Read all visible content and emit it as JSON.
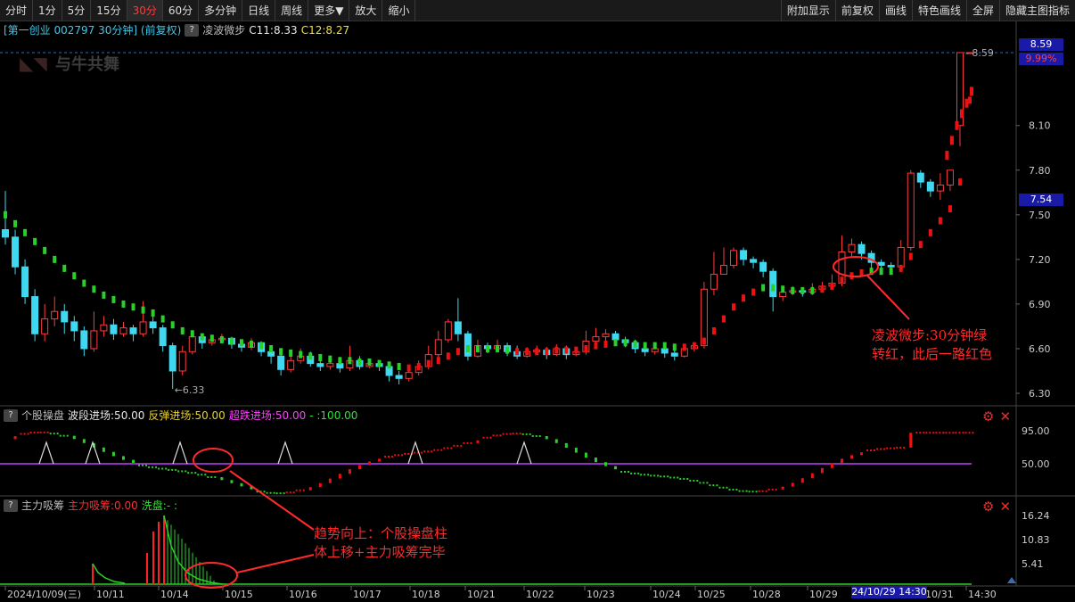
{
  "toolbar": {
    "left": [
      "分时",
      "1分",
      "5分",
      "15分",
      "30分",
      "60分",
      "多分钟",
      "日线",
      "周线",
      "更多▼",
      "放大",
      "缩小"
    ],
    "active": "30分",
    "right": [
      "附加显示",
      "前复权",
      "画线",
      "特色画线",
      "全屏",
      "隐藏主图指标"
    ]
  },
  "main": {
    "title": "[第一创业 002797 30分钟] (前复权)",
    "indicator_name": "凌波微步",
    "c11": "C11:8.33",
    "c12": "C12:8.27",
    "watermark": "与牛共舞",
    "price_ticks": [
      "8.10",
      "7.80",
      "7.50",
      "7.20",
      "6.90",
      "6.60",
      "6.30"
    ],
    "current_price": "8.59",
    "current_pct": "9.99%",
    "cursor_price": "7.54",
    "high_label": "8.59",
    "low_label": "6.33"
  },
  "pane2": {
    "name": "个股操盘",
    "labels": [
      {
        "text": "波段进场:50.00",
        "color": "#e8e8e8"
      },
      {
        "text": "反弹进场:50.00",
        "color": "#e8d030"
      },
      {
        "text": "超跌进场:50.00",
        "color": "#ff40ff"
      },
      {
        "text": "- :100.00",
        "color": "#35e035"
      }
    ],
    "ticks": [
      "95.00",
      "50.00"
    ]
  },
  "pane3": {
    "name": "主力吸筹",
    "labels": [
      {
        "text": "主力吸筹:0.00",
        "color": "#ff3030"
      },
      {
        "text": "洗盘:- :",
        "color": "#35e035"
      }
    ],
    "ticks": [
      "16.24",
      "10.83",
      "5.41"
    ]
  },
  "dates": [
    "2024/10/09(三)",
    "10/11",
    "10/14",
    "10/15",
    "10/16",
    "10/17",
    "10/18",
    "10/21",
    "10/22",
    "10/23",
    "10/24",
    "10/25",
    "10/28",
    "10/29",
    "10/31",
    "14:30"
  ],
  "cursor_date": "24/10/29 14:30",
  "annotations": {
    "right": [
      "凌波微步:30分钟绿",
      "转红，此后一路红色"
    ],
    "bottom": [
      "趋势向上：个股操盘柱",
      "体上移+主力吸筹完毕"
    ]
  },
  "colors": {
    "up": "#ff3b3b",
    "down": "#3fd8f0",
    "ma_green": "#2ad02a",
    "ma_red": "#ee1111",
    "midline": "#c040ff",
    "annotation": "#ff2a2a"
  },
  "chart_data": {
    "type": "candlestick",
    "interval": "30分钟",
    "candles": [
      [
        7.4,
        7.35,
        7.66,
        7.3
      ],
      [
        7.35,
        7.15,
        7.4,
        7.1
      ],
      [
        7.15,
        6.95,
        7.2,
        6.9
      ],
      [
        6.95,
        6.7,
        7.0,
        6.65
      ],
      [
        6.7,
        6.8,
        6.9,
        6.65
      ],
      [
        6.8,
        6.85,
        6.95,
        6.75
      ],
      [
        6.85,
        6.78,
        6.9,
        6.7
      ],
      [
        6.78,
        6.72,
        6.82,
        6.65
      ],
      [
        6.72,
        6.6,
        6.75,
        6.55
      ],
      [
        6.6,
        6.72,
        6.85,
        6.58
      ],
      [
        6.72,
        6.76,
        6.82,
        6.68
      ],
      [
        6.76,
        6.7,
        6.8,
        6.66
      ],
      [
        6.7,
        6.74,
        6.78,
        6.68
      ],
      [
        6.74,
        6.7,
        6.76,
        6.65
      ],
      [
        6.7,
        6.78,
        6.92,
        6.68
      ],
      [
        6.78,
        6.74,
        6.82,
        6.7
      ],
      [
        6.74,
        6.62,
        6.76,
        6.58
      ],
      [
        6.62,
        6.45,
        6.64,
        6.33
      ],
      [
        6.45,
        6.58,
        6.62,
        6.42
      ],
      [
        6.58,
        6.68,
        6.72,
        6.56
      ],
      [
        6.68,
        6.64,
        6.7,
        6.6
      ],
      [
        6.64,
        6.66,
        6.68,
        6.62
      ],
      [
        6.66,
        6.67,
        6.7,
        6.64
      ],
      [
        6.67,
        6.63,
        6.68,
        6.6
      ],
      [
        6.63,
        6.61,
        6.66,
        6.58
      ],
      [
        6.61,
        6.64,
        6.67,
        6.59
      ],
      [
        6.64,
        6.58,
        6.65,
        6.55
      ],
      [
        6.58,
        6.55,
        6.6,
        6.5
      ],
      [
        6.55,
        6.46,
        6.57,
        6.42
      ],
      [
        6.46,
        6.52,
        6.56,
        6.44
      ],
      [
        6.52,
        6.55,
        6.6,
        6.5
      ],
      [
        6.55,
        6.5,
        6.58,
        6.48
      ],
      [
        6.5,
        6.48,
        6.53,
        6.45
      ],
      [
        6.48,
        6.5,
        6.55,
        6.46
      ],
      [
        6.5,
        6.47,
        6.52,
        6.44
      ],
      [
        6.47,
        6.52,
        6.62,
        6.45
      ],
      [
        6.52,
        6.48,
        6.55,
        6.46
      ],
      [
        6.48,
        6.5,
        6.53,
        6.47
      ],
      [
        6.5,
        6.48,
        6.52,
        6.45
      ],
      [
        6.48,
        6.42,
        6.5,
        6.38
      ],
      [
        6.42,
        6.4,
        6.45,
        6.36
      ],
      [
        6.4,
        6.44,
        6.46,
        6.38
      ],
      [
        6.44,
        6.48,
        6.52,
        6.42
      ],
      [
        6.48,
        6.56,
        6.62,
        6.46
      ],
      [
        6.56,
        6.66,
        6.72,
        6.54
      ],
      [
        6.66,
        6.78,
        6.8,
        6.64
      ],
      [
        6.78,
        6.7,
        6.94,
        6.65
      ],
      [
        6.7,
        6.55,
        6.72,
        6.52
      ],
      [
        6.55,
        6.62,
        6.66,
        6.54
      ],
      [
        6.62,
        6.6,
        6.64,
        6.57
      ],
      [
        6.6,
        6.62,
        6.66,
        6.58
      ],
      [
        6.62,
        6.58,
        6.64,
        6.55
      ],
      [
        6.58,
        6.55,
        6.62,
        6.53
      ],
      [
        6.55,
        6.58,
        6.61,
        6.54
      ],
      [
        6.58,
        6.59,
        6.62,
        6.56
      ],
      [
        6.59,
        6.56,
        6.61,
        6.53
      ],
      [
        6.56,
        6.6,
        6.63,
        6.55
      ],
      [
        6.6,
        6.56,
        6.62,
        6.53
      ],
      [
        6.56,
        6.58,
        6.6,
        6.55
      ],
      [
        6.58,
        6.65,
        6.72,
        6.56
      ],
      [
        6.65,
        6.68,
        6.74,
        6.62
      ],
      [
        6.68,
        6.7,
        6.73,
        6.64
      ],
      [
        6.7,
        6.66,
        6.72,
        6.62
      ],
      [
        6.66,
        6.64,
        6.68,
        6.61
      ],
      [
        6.64,
        6.6,
        6.66,
        6.57
      ],
      [
        6.6,
        6.58,
        6.62,
        6.55
      ],
      [
        6.58,
        6.6,
        6.62,
        6.56
      ],
      [
        6.6,
        6.57,
        6.62,
        6.54
      ],
      [
        6.57,
        6.55,
        6.59,
        6.52
      ],
      [
        6.55,
        6.6,
        6.63,
        6.54
      ],
      [
        6.6,
        6.62,
        6.64,
        6.58
      ],
      [
        6.62,
        7.0,
        7.05,
        6.6
      ],
      [
        7.0,
        7.1,
        7.25,
        6.96
      ],
      [
        7.1,
        7.16,
        7.28,
        7.1
      ],
      [
        7.16,
        7.26,
        7.28,
        7.14
      ],
      [
        7.26,
        7.2,
        7.28,
        7.16
      ],
      [
        7.2,
        7.18,
        7.22,
        7.14
      ],
      [
        7.18,
        7.12,
        7.2,
        7.08
      ],
      [
        7.12,
        6.95,
        7.14,
        6.85
      ],
      [
        6.95,
        6.98,
        7.02,
        6.92
      ],
      [
        6.98,
        6.99,
        7.02,
        6.96
      ],
      [
        6.99,
        6.98,
        7.01,
        6.95
      ],
      [
        6.98,
        7.0,
        7.04,
        6.96
      ],
      [
        7.0,
        7.02,
        7.05,
        6.98
      ],
      [
        7.02,
        7.04,
        7.1,
        7.0
      ],
      [
        7.04,
        7.25,
        7.36,
        7.02
      ],
      [
        7.25,
        7.3,
        7.34,
        7.22
      ],
      [
        7.3,
        7.24,
        7.32,
        7.2
      ],
      [
        7.24,
        7.18,
        7.26,
        7.14
      ],
      [
        7.18,
        7.16,
        7.2,
        7.12
      ],
      [
        7.16,
        7.15,
        7.18,
        7.13
      ],
      [
        7.15,
        7.28,
        7.33,
        7.12
      ],
      [
        7.28,
        7.78,
        7.8,
        7.26
      ],
      [
        7.78,
        7.72,
        7.8,
        7.68
      ],
      [
        7.72,
        7.66,
        7.74,
        7.62
      ],
      [
        7.66,
        7.7,
        7.78,
        7.6
      ],
      [
        7.7,
        7.8,
        7.8,
        7.66
      ],
      [
        8.1,
        8.59,
        8.59,
        7.96
      ],
      [
        8.59,
        8.59,
        8.59,
        8.59
      ]
    ],
    "lingbo_weibu": [
      [
        7.5,
        "g"
      ],
      [
        7.44,
        "g"
      ],
      [
        7.38,
        "g"
      ],
      [
        7.32,
        "g"
      ],
      [
        7.26,
        "g"
      ],
      [
        7.2,
        "g"
      ],
      [
        7.14,
        "g"
      ],
      [
        7.09,
        "g"
      ],
      [
        7.04,
        "g"
      ],
      [
        7.0,
        "g"
      ],
      [
        6.96,
        "g"
      ],
      [
        6.93,
        "g"
      ],
      [
        6.9,
        "g"
      ],
      [
        6.88,
        "g"
      ],
      [
        6.86,
        "g"
      ],
      [
        6.84,
        "g"
      ],
      [
        6.8,
        "g"
      ],
      [
        6.76,
        "g"
      ],
      [
        6.72,
        "g"
      ],
      [
        6.7,
        "g"
      ],
      [
        6.68,
        "g"
      ],
      [
        6.67,
        "g"
      ],
      [
        6.66,
        "g"
      ],
      [
        6.65,
        "g"
      ],
      [
        6.64,
        "g"
      ],
      [
        6.63,
        "g"
      ],
      [
        6.62,
        "g"
      ],
      [
        6.6,
        "g"
      ],
      [
        6.58,
        "g"
      ],
      [
        6.57,
        "g"
      ],
      [
        6.56,
        "g"
      ],
      [
        6.55,
        "g"
      ],
      [
        6.54,
        "g"
      ],
      [
        6.53,
        "g"
      ],
      [
        6.52,
        "g"
      ],
      [
        6.52,
        "g"
      ],
      [
        6.51,
        "g"
      ],
      [
        6.51,
        "g"
      ],
      [
        6.5,
        "g"
      ],
      [
        6.49,
        "g"
      ],
      [
        6.48,
        "g"
      ],
      [
        6.47,
        "r"
      ],
      [
        6.48,
        "r"
      ],
      [
        6.5,
        "r"
      ],
      [
        6.52,
        "r"
      ],
      [
        6.55,
        "r"
      ],
      [
        6.58,
        "r"
      ],
      [
        6.6,
        "g"
      ],
      [
        6.6,
        "g"
      ],
      [
        6.6,
        "g"
      ],
      [
        6.6,
        "g"
      ],
      [
        6.59,
        "g"
      ],
      [
        6.58,
        "r"
      ],
      [
        6.58,
        "r"
      ],
      [
        6.58,
        "r"
      ],
      [
        6.58,
        "r"
      ],
      [
        6.59,
        "r"
      ],
      [
        6.59,
        "r"
      ],
      [
        6.59,
        "r"
      ],
      [
        6.6,
        "r"
      ],
      [
        6.62,
        "r"
      ],
      [
        6.63,
        "r"
      ],
      [
        6.64,
        "g"
      ],
      [
        6.64,
        "g"
      ],
      [
        6.63,
        "g"
      ],
      [
        6.62,
        "g"
      ],
      [
        6.62,
        "g"
      ],
      [
        6.62,
        "g"
      ],
      [
        6.61,
        "g"
      ],
      [
        6.61,
        "r"
      ],
      [
        6.62,
        "r"
      ],
      [
        6.65,
        "r"
      ],
      [
        6.72,
        "r"
      ],
      [
        6.8,
        "r"
      ],
      [
        6.88,
        "r"
      ],
      [
        6.94,
        "r"
      ],
      [
        6.98,
        "r"
      ],
      [
        7.01,
        "g"
      ],
      [
        7.01,
        "g"
      ],
      [
        7.0,
        "g"
      ],
      [
        6.99,
        "g"
      ],
      [
        6.99,
        "g"
      ],
      [
        6.99,
        "g"
      ],
      [
        7.0,
        "r"
      ],
      [
        7.02,
        "r"
      ],
      [
        7.06,
        "r"
      ],
      [
        7.09,
        "r"
      ],
      [
        7.11,
        "r"
      ],
      [
        7.12,
        "g"
      ],
      [
        7.12,
        "g"
      ],
      [
        7.12,
        "g"
      ],
      [
        7.14,
        "r"
      ],
      [
        7.22,
        "r"
      ],
      [
        7.3,
        "r"
      ],
      [
        7.38,
        "r"
      ],
      [
        7.46,
        "r"
      ],
      [
        7.54,
        "r"
      ],
      [
        7.72,
        "r"
      ],
      [
        8.27,
        "r"
      ]
    ],
    "ma_tail": [
      7.9,
      8.0,
      8.1,
      8.18,
      8.25,
      8.33
    ],
    "ylim": [
      6.3,
      8.59
    ]
  }
}
